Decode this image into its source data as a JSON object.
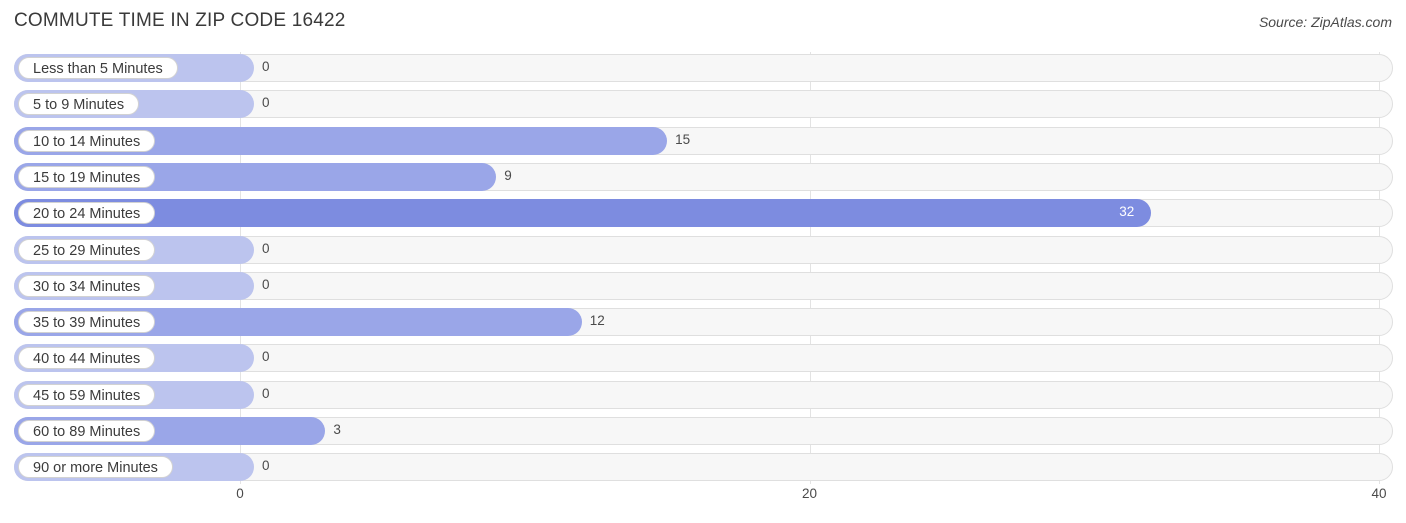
{
  "header": {
    "title": "COMMUTE TIME IN ZIP CODE 16422",
    "source": "Source: ZipAtlas.com"
  },
  "colors": {
    "bar": "#9aa6e8",
    "bar_zero": "#bcc4ee",
    "bar_max": "#7d8ce0",
    "track": "#f7f7f7",
    "grid": "#e3e3e3"
  },
  "chart_data": {
    "type": "bar",
    "orientation": "horizontal",
    "title": "COMMUTE TIME IN ZIP CODE 16422",
    "xlabel": "",
    "ylabel": "",
    "xlim": [
      0,
      40
    ],
    "xticks": [
      "0",
      "20",
      "40"
    ],
    "xtick_values": [
      0,
      20,
      40
    ],
    "grid": true,
    "categories": [
      "Less than 5 Minutes",
      "5 to 9 Minutes",
      "10 to 14 Minutes",
      "15 to 19 Minutes",
      "20 to 24 Minutes",
      "25 to 29 Minutes",
      "30 to 34 Minutes",
      "35 to 39 Minutes",
      "40 to 44 Minutes",
      "45 to 59 Minutes",
      "60 to 89 Minutes",
      "90 or more Minutes"
    ],
    "values": [
      0,
      0,
      15,
      9,
      32,
      0,
      0,
      12,
      0,
      0,
      3,
      0
    ],
    "value_labels": [
      "0",
      "0",
      "15",
      "9",
      "32",
      "0",
      "0",
      "12",
      "0",
      "0",
      "3",
      "0"
    ]
  }
}
